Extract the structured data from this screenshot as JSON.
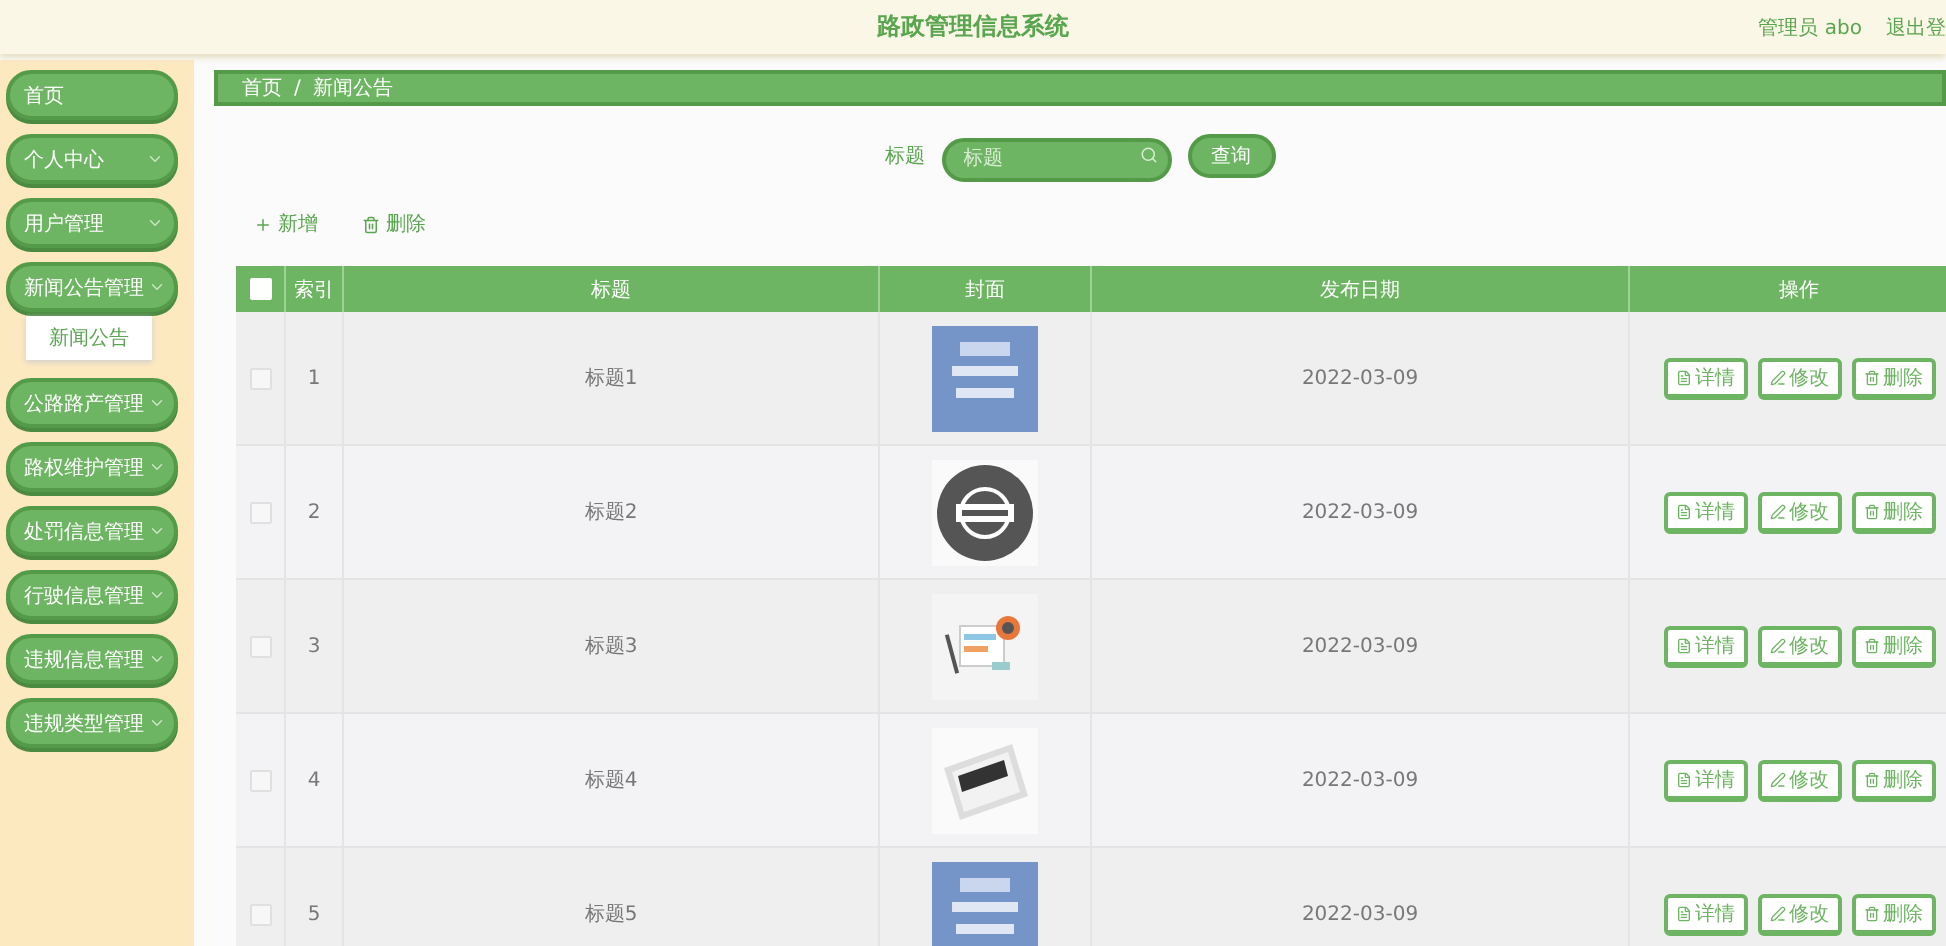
{
  "header": {
    "title": "路政管理信息系统",
    "user": "管理员 abo",
    "logout": "退出登"
  },
  "sidebar": {
    "items": [
      {
        "label": "首页",
        "kind": "link"
      },
      {
        "label": "个人中心",
        "kind": "menu"
      },
      {
        "label": "用户管理",
        "kind": "menu"
      },
      {
        "label": "新闻公告管理",
        "kind": "menu",
        "children": [
          {
            "label": "新闻公告"
          }
        ]
      },
      {
        "label": "公路路产管理",
        "kind": "menu"
      },
      {
        "label": "路权维护管理",
        "kind": "menu"
      },
      {
        "label": "处罚信息管理",
        "kind": "menu"
      },
      {
        "label": "行驶信息管理",
        "kind": "menu"
      },
      {
        "label": "违规信息管理",
        "kind": "menu"
      },
      {
        "label": "违规类型管理",
        "kind": "menu"
      }
    ]
  },
  "breadcrumb": [
    "首页",
    "/",
    "新闻公告"
  ],
  "search": {
    "label": "标题",
    "placeholder": "标题",
    "button": "查询"
  },
  "toolbar": [
    "新增",
    "删除"
  ],
  "table": {
    "header_checked": false,
    "columns": [
      "索引",
      "标题",
      "封面",
      "发布日期",
      "操作"
    ],
    "rows": [
      {
        "checked": false,
        "index": "1",
        "title": "标题1",
        "date": "2022-03-09",
        "actions": [
          "详情",
          "修改",
          "删除"
        ]
      },
      {
        "checked": false,
        "index": "2",
        "title": "标题2",
        "date": "2022-03-09",
        "actions": [
          "详情",
          "修改",
          "删除"
        ]
      },
      {
        "checked": false,
        "index": "3",
        "title": "标题3",
        "date": "2022-03-09",
        "actions": [
          "详情",
          "修改",
          "删除"
        ]
      },
      {
        "checked": false,
        "index": "4",
        "title": "标题4",
        "date": "2022-03-09",
        "actions": [
          "详情",
          "修改",
          "删除"
        ]
      },
      {
        "checked": false,
        "index": "5",
        "title": "标题5",
        "date": "2022-03-09",
        "actions": [
          "详情",
          "修改",
          "删除"
        ]
      }
    ]
  }
}
